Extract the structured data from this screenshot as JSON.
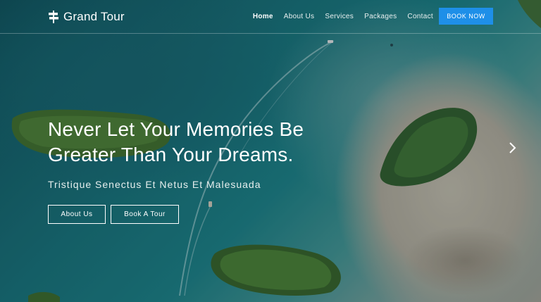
{
  "brand": {
    "name": "Grand Tour",
    "icon": "signpost-icon"
  },
  "nav": {
    "items": [
      {
        "label": "Home",
        "active": true
      },
      {
        "label": "About Us",
        "active": false
      },
      {
        "label": "Services",
        "active": false
      },
      {
        "label": "Packages",
        "active": false
      },
      {
        "label": "Contact",
        "active": false
      }
    ],
    "cta_label": "BOOK NOW"
  },
  "hero": {
    "headline_line1": "Never Let Your Memories Be",
    "headline_line2": "Greater Than Your Dreams.",
    "subheading": "Tristique Senectus Et Netus Et Malesuada",
    "buttons": [
      {
        "label": "About Us"
      },
      {
        "label": "Book A Tour"
      }
    ],
    "next_icon": "chevron-right-icon"
  },
  "colors": {
    "accent": "#1e8fe8",
    "text": "#ffffff",
    "sea": "#176c73",
    "sand": "#b9b3a3",
    "forest": "#3f6b2a"
  }
}
